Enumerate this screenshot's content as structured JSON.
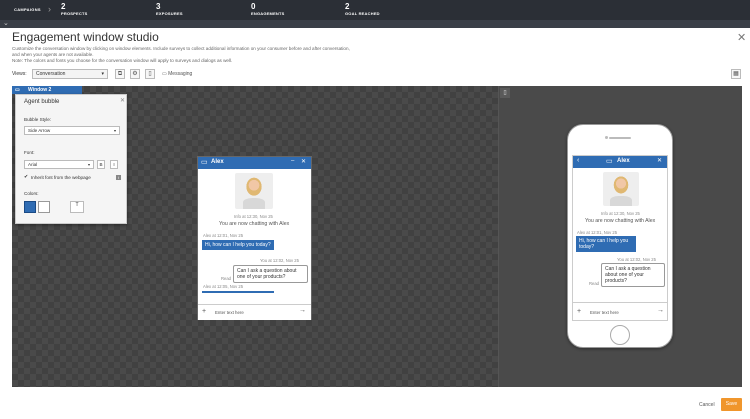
{
  "topbar": {
    "crumb": "CAMPAIGNS",
    "stats": [
      {
        "num": "2",
        "label": "PROSPECTS"
      },
      {
        "num": "3",
        "label": "EXPOSURES"
      },
      {
        "num": "0",
        "label": "ENGAGEMENTS"
      },
      {
        "num": "2",
        "label": "GOAL REACHED"
      }
    ]
  },
  "header": {
    "title": "Engagement window studio",
    "desc1": "Customize the conversation window by clicking on window elements. Include surveys to collect additional information on your consumer before and after conversation,",
    "desc2": "and when your agents are not available.",
    "desc3": "Note: The colors and fonts you choose for the conversation window will apply to surveys and dialogs as well.",
    "views_label": "Views:",
    "views_value": "Conversation",
    "messaging": "Messaging"
  },
  "window_tab": "Window 2",
  "panel": {
    "title": "Agent bubble",
    "bubble_style_label": "Bubble Style:",
    "bubble_style_value": "Side Arrow",
    "font_label": "Font:",
    "font_value": "Arial",
    "bold": "B",
    "italic": "I",
    "inherit_label": "Inherit font from the webpage",
    "colors_label": "Colors:",
    "text_btn": "T",
    "colors": {
      "accent": "#2f6cb3"
    }
  },
  "chat": {
    "agent_name": "Alex",
    "info_line": "Info at 12:30, Nov 25",
    "now_chatting": "You are now chatting with Alex",
    "agent_ts": "Alex at 12:01, Nov 25",
    "agent_msg": "Hi, how can I help you today?",
    "user_ts": "You at 12:02, Nov 25",
    "user_msg": "Can I ask a question about one of your products?",
    "read": "Read",
    "agent_ts2": "Alex at 12:05, Nov 25",
    "input_placeholder": "Enter text here"
  },
  "footer": {
    "cancel": "Cancel",
    "save": "Save"
  }
}
